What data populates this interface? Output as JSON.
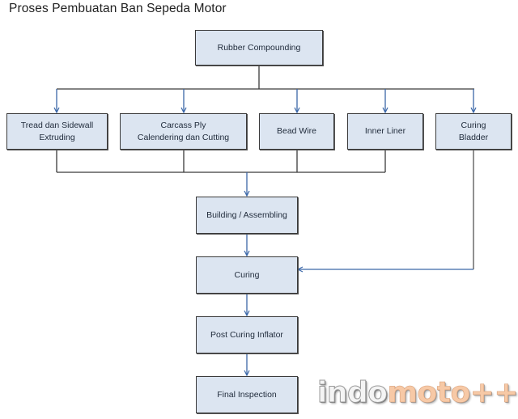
{
  "title": "Proses Pembuatan Ban Sepeda Motor",
  "nodes": {
    "rubber_compounding": "Rubber Compounding",
    "tread_sidewall": "Tread dan Sidewall\nExtruding",
    "carcass_ply": "Carcass Ply\nCalendering dan Cutting",
    "bead_wire": "Bead Wire",
    "inner_liner": "Inner Liner",
    "curing_bladder": "Curing\nBladder",
    "building": "Building / Assembling",
    "curing": "Curing",
    "post_curing": "Post Curing Inflator",
    "final_inspection": "Final Inspection"
  },
  "edges": [
    {
      "from": "Rubber Compounding",
      "to": "Tread dan Sidewall Extruding"
    },
    {
      "from": "Rubber Compounding",
      "to": "Carcass Ply Calendering dan Cutting"
    },
    {
      "from": "Rubber Compounding",
      "to": "Bead Wire"
    },
    {
      "from": "Rubber Compounding",
      "to": "Inner Liner"
    },
    {
      "from": "Rubber Compounding",
      "to": "Curing Bladder"
    },
    {
      "from": "Tread dan Sidewall Extruding",
      "to": "Building / Assembling"
    },
    {
      "from": "Carcass Ply Calendering dan Cutting",
      "to": "Building / Assembling"
    },
    {
      "from": "Bead Wire",
      "to": "Building / Assembling"
    },
    {
      "from": "Inner Liner",
      "to": "Building / Assembling"
    },
    {
      "from": "Building / Assembling",
      "to": "Curing"
    },
    {
      "from": "Curing Bladder",
      "to": "Curing"
    },
    {
      "from": "Curing",
      "to": "Post Curing Inflator"
    },
    {
      "from": "Post Curing Inflator",
      "to": "Final Inspection"
    }
  ],
  "watermark": {
    "part1": "indo",
    "part2": "moto",
    "part3": "++"
  },
  "colors": {
    "box_fill": "#dce5f1",
    "arrow": "#3b67a8",
    "line": "#3a3a3a",
    "watermark_accent": "#f7c9a6"
  }
}
